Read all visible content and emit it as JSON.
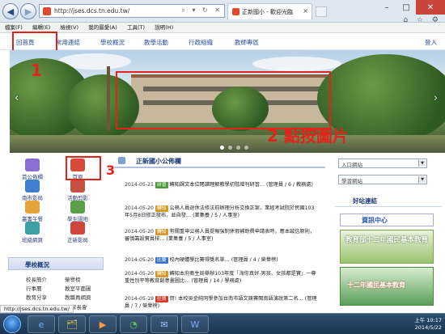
{
  "browser": {
    "url": "http://jses.dcs.tn.edu.tw/",
    "tab_title": "正新國小 - 歡迎光臨",
    "tab_close": "×",
    "nav_back": "◀",
    "nav_forward": "▶",
    "new_tab": "",
    "window_controls": {
      "min": "–",
      "max": "□",
      "close": "✕"
    },
    "toolbar_icons": "⌂ ☆ ⚙"
  },
  "menubar": [
    "檔案(F)",
    "編輯(E)",
    "檢視(V)",
    "我的最愛(A)",
    "工具(T)",
    "說明(H)"
  ],
  "site_nav": {
    "items": [
      "回首頁",
      "常用連結",
      "學校概況",
      "教學活動",
      "行政組織",
      "教師專區"
    ],
    "login": "登入"
  },
  "annotations": {
    "step1": "1",
    "step2": "2 點按圖片",
    "step3": "3"
  },
  "banner": {
    "prev": "‹",
    "next": "›"
  },
  "left_icons": [
    {
      "label": "首公佈欄",
      "color": "#8b6fd6"
    },
    {
      "label": "首頁",
      "color": "#d94a3a"
    },
    {
      "label": "南市影局",
      "color": "#3e7fd1"
    },
    {
      "label": "活動剪影",
      "color": "#c9503f"
    },
    {
      "label": "叢書午餐",
      "color": "#e7a23a"
    },
    {
      "label": "學生園地",
      "color": "#5aa04a"
    },
    {
      "label": "班級網頁",
      "color": "#3ea0a7"
    },
    {
      "label": "正新影局",
      "color": "#d0463a"
    }
  ],
  "school_section": {
    "title": "學校概況",
    "links": [
      "校長簡介",
      "榮譽榜",
      "行事曆",
      "教室平面圖",
      "教育分享",
      "教職員網頁",
      "",
      "家長會"
    ]
  },
  "board": {
    "title": "正新國小公佈欄",
    "items": [
      {
        "date": "2014-05-21",
        "badge": "研習",
        "badge_color": "#4a9a3b",
        "text": "轉知課文本位閱讀理解教學初階增刊研習… (管理員 / 6 / 教務處)"
      },
      {
        "date": "2014-05-20",
        "badge": "轉知",
        "badge_color": "#d49a2a",
        "text": "公務人員退休法修法前辦理分析交換正案，業經考試院於民國103年5月8日修正發布，並自發… (業集養 / 5 / 人事室)"
      },
      {
        "date": "2014-05-20",
        "badge": "轉知",
        "badge_color": "#d49a2a",
        "text": "有關重申公務人員提報強制休假補助費申請表時，應本誠信原則，審慎籌設實員核… (業集養 / 5 / 人事室)"
      },
      {
        "date": "2014-05-20",
        "badge": "比賽",
        "badge_color": "#3a74c9",
        "text": "校內硬體學比賽得獎名單… (管理員 / 4 / 榮譽榜)"
      },
      {
        "date": "2014-05-20",
        "badge": "轉知",
        "badge_color": "#d49a2a",
        "text": "轉知本府衛生局舉辦103年度「海你真好-男孩、女孩都是寶」一尊重性別平等教育創意畫圖比… (管理員 / 14 / 學務處)"
      },
      {
        "date": "2014-05-19",
        "badge": "狂賀",
        "badge_color": "#d03a2a",
        "text": "賀! 本校吳金純同學參加台南市語文競賽閩南語演說第二名… (管理員 / 7 / 榮譽榜)"
      }
    ]
  },
  "right": {
    "select1": "入口網站",
    "select2": "學習網站",
    "friends_title": "好站連結",
    "banner_resource": "資訊中心",
    "banner_edu": "教育部十二年國民基本教育",
    "banner_edu2": "十二年國民基本教育"
  },
  "status_url": "http://jses.dcs.tn.edu.tw/",
  "taskbar": {
    "apps": [
      "e",
      "🗂",
      "▶",
      "◔",
      "✉",
      "W"
    ],
    "time": "上午 10:17",
    "date": "2014/5/22"
  }
}
